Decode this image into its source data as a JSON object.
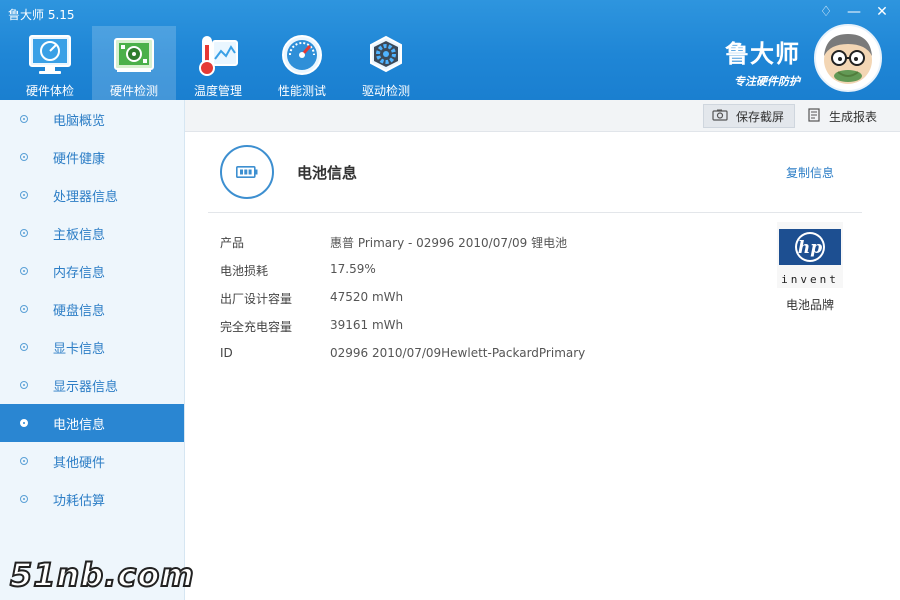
{
  "app": {
    "title": "鲁大师 5.15"
  },
  "window_controls": {
    "skin": "♢",
    "minimize": "—",
    "close": "✕"
  },
  "nav": {
    "items": [
      {
        "label": "硬件体检",
        "icon": "monitor-check-icon",
        "active": false
      },
      {
        "label": "硬件检测",
        "icon": "circuit-board-icon",
        "active": true
      },
      {
        "label": "温度管理",
        "icon": "thermometer-icon",
        "active": false
      },
      {
        "label": "性能测试",
        "icon": "speedometer-icon",
        "active": false
      },
      {
        "label": "驱动检测",
        "icon": "gear-driver-icon",
        "active": false
      }
    ]
  },
  "brand": {
    "name": "鲁大师",
    "slogan": "专注硬件防护"
  },
  "sidebar": {
    "items": [
      {
        "label": "电脑概览"
      },
      {
        "label": "硬件健康"
      },
      {
        "label": "处理器信息"
      },
      {
        "label": "主板信息"
      },
      {
        "label": "内存信息"
      },
      {
        "label": "硬盘信息"
      },
      {
        "label": "显卡信息"
      },
      {
        "label": "显示器信息"
      },
      {
        "label": "电池信息"
      },
      {
        "label": "其他硬件"
      },
      {
        "label": "功耗估算"
      }
    ],
    "active_index": 8
  },
  "toolbar": {
    "screenshot_label": "保存截屏",
    "report_label": "生成报表"
  },
  "section": {
    "title": "电池信息",
    "copy_label": "复制信息"
  },
  "battery": {
    "rows": [
      {
        "key": "产品",
        "value": "惠普 Primary - 02996 2010/07/09 锂电池"
      },
      {
        "key": "电池损耗",
        "value": "17.59%"
      },
      {
        "key": "出厂设计容量",
        "value": "47520 mWh"
      },
      {
        "key": "完全充电容量",
        "value": "39161 mWh"
      },
      {
        "key": "ID",
        "value": "02996 2010/07/09Hewlett-PackardPrimary"
      }
    ],
    "brand_caption": "电池品牌",
    "brand_logo_text": "invent"
  },
  "watermark": {
    "text": "51nb.com"
  },
  "colors": {
    "header": "#1f86d6",
    "accent": "#2a86d2",
    "sidebar_bg": "#eef6fc",
    "link": "#2d7ec6"
  }
}
